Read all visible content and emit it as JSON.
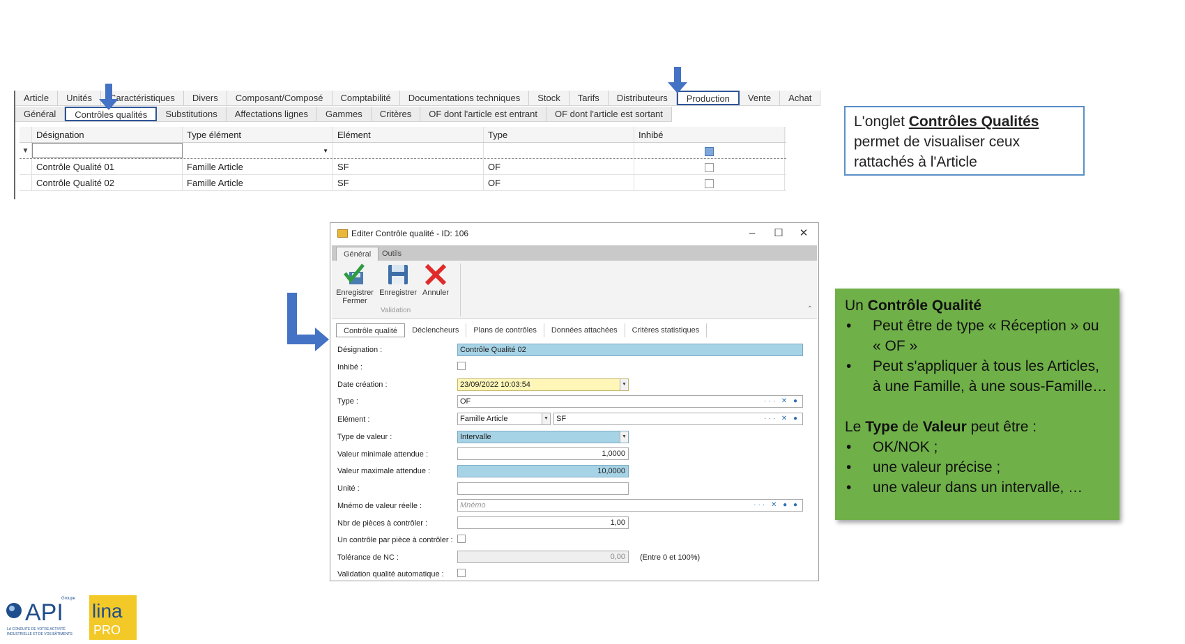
{
  "top_grid": {
    "tabs_row1": [
      {
        "label": "Article"
      },
      {
        "label": "Unités"
      },
      {
        "label": "Caractéristiques"
      },
      {
        "label": "Divers"
      },
      {
        "label": "Composant/Composé"
      },
      {
        "label": "Comptabilité"
      },
      {
        "label": "Documentations techniques"
      },
      {
        "label": "Stock"
      },
      {
        "label": "Tarifs"
      },
      {
        "label": "Distributeurs"
      },
      {
        "label": "Production",
        "selected": true
      },
      {
        "label": "Vente"
      },
      {
        "label": "Achat"
      }
    ],
    "tabs_row2": [
      {
        "label": "Général"
      },
      {
        "label": "Contrôles qualités",
        "selected": true
      },
      {
        "label": "Substitutions"
      },
      {
        "label": "Affectations lignes"
      },
      {
        "label": "Gammes"
      },
      {
        "label": "Critères"
      },
      {
        "label": "OF dont l'article est entrant"
      },
      {
        "label": "OF dont l'article est sortant"
      }
    ],
    "columns": [
      "Désignation",
      "Type élément",
      "Elément",
      "Type",
      "Inhibé"
    ],
    "rows": [
      {
        "designation": "Contrôle Qualité 01",
        "type_element": "Famille Article",
        "element": "SF",
        "type": "OF",
        "inhibe": false
      },
      {
        "designation": "Contrôle Qualité 02",
        "type_element": "Famille Article",
        "element": "SF",
        "type": "OF",
        "inhibe": false
      }
    ],
    "filter_icon": "filter-pin-icon"
  },
  "callout1": {
    "prefix": "L'onglet ",
    "bold": "Contrôles Qualités",
    "rest": " permet de visualiser ceux rattachés à l'Article"
  },
  "dialog": {
    "title": "Editer Contrôle qualité - ID: 106",
    "window_controls": {
      "minimize": "–",
      "maximize": "☐",
      "close": "✕"
    },
    "ribbon_tabs": [
      "Général",
      "Outils"
    ],
    "ribbon_buttons": [
      {
        "label": "Enregistrer Fermer",
        "icon": "save-close-icon"
      },
      {
        "label": "Enregistrer",
        "icon": "save-icon"
      },
      {
        "label": "Annuler",
        "icon": "cancel-icon"
      }
    ],
    "ribbon_group": "Validation",
    "sub_tabs": [
      "Contrôle qualité",
      "Déclencheurs",
      "Plans de contrôles",
      "Données attachées",
      "Critères statistiques"
    ],
    "fields": {
      "designation": {
        "label": "Désignation :",
        "value": "Contrôle Qualité 02"
      },
      "inhibe": {
        "label": "Inhibé :",
        "checked": false
      },
      "date_creation": {
        "label": "Date création :",
        "value": "23/09/2022 10:03:54"
      },
      "type": {
        "label": "Type :",
        "value": "OF"
      },
      "element": {
        "label": "Elément :",
        "value1": "Famille Article",
        "value2": "SF"
      },
      "type_valeur": {
        "label": "Type de valeur :",
        "value": "Intervalle"
      },
      "valeur_min": {
        "label": "Valeur minimale attendue :",
        "value": "1,0000"
      },
      "valeur_max": {
        "label": "Valeur maximale attendue :",
        "value": "10,0000"
      },
      "unite": {
        "label": "Unité :",
        "value": ""
      },
      "mnemo": {
        "label": "Mnémo de valeur réelle :",
        "placeholder": "Mnémo"
      },
      "nbr_pieces": {
        "label": "Nbr de pièces à contrôler :",
        "value": "1,00"
      },
      "un_controle": {
        "label": "Un contrôle par pièce à contrôler :",
        "checked": false
      },
      "tolerance": {
        "label": "Tolérance de NC :",
        "value": "0,00",
        "hint": "(Entre 0 et 100%)"
      },
      "validation_auto": {
        "label": "Validation qualité automatique :",
        "checked": false
      }
    }
  },
  "callout2": {
    "line1_prefix": "Un ",
    "line1_bold": "Contrôle Qualité",
    "bullets1": [
      "Peut être de type « Réception » ou « OF »",
      "Peut s'appliquer à tous les Articles, à une Famille, à une sous-Famille…"
    ],
    "line2_prefix": "Le ",
    "line2_bold1": "Type",
    "line2_mid": " de ",
    "line2_bold2": "Valeur",
    "line2_suffix": " peut être :",
    "bullets2": [
      "OK/NOK ;",
      "une valeur précise ;",
      "une valeur dans un intervalle, …"
    ],
    "background": "#6fb048"
  },
  "logos": {
    "api_text": "API",
    "api_groupe": "Groupe",
    "api_tagline": "LA CONDUITE DE VOTRE ACTIVITÉ INDUSTRIELLE ET DE VOS BÂTIMENTS",
    "lina_text": "lina",
    "lina_pro": "PRO"
  },
  "colors": {
    "accent_blue": "#4472c4",
    "selection_blue": "#a7d3e6",
    "date_yellow": "#fff6b8"
  }
}
